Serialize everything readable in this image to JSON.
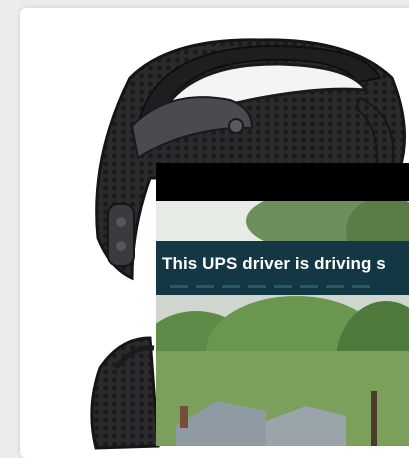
{
  "product": {
    "image_name": "sport-mesh-face-mask",
    "colors": {
      "mask": "#2b2b2e",
      "strap": "#1e1e20",
      "valve": "#4a4a50"
    }
  },
  "video": {
    "caption": "This UPS driver is driving s",
    "caption_color": "#133844"
  }
}
